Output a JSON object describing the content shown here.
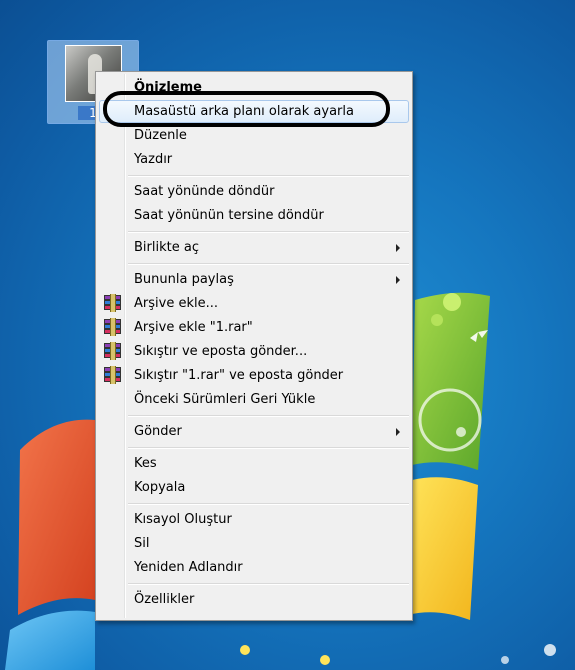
{
  "desktop": {
    "icon_label": "1",
    "accent_colors": {
      "background": "#1576bf",
      "menu_bg": "#f0f0f0",
      "hover": "#dfedfb"
    }
  },
  "context_menu": {
    "items": [
      {
        "label": "Önizleme",
        "bold": true
      },
      {
        "label": "Masaüstü arka planı olarak ayarla",
        "highlighted": true
      },
      {
        "label": "Düzenle"
      },
      {
        "label": "Yazdır"
      },
      {
        "label": "Saat yönünde döndür"
      },
      {
        "label": "Saat yönünün tersine döndür"
      },
      {
        "label": "Birlikte aç",
        "submenu": true
      },
      {
        "label": "Bununla paylaş",
        "submenu": true
      },
      {
        "label": "Arşive ekle...",
        "icon": "winrar-icon"
      },
      {
        "label": "Arşive ekle \"1.rar\"",
        "icon": "winrar-icon"
      },
      {
        "label": "Sıkıştır ve eposta gönder...",
        "icon": "winrar-icon"
      },
      {
        "label": "Sıkıştır \"1.rar\" ve eposta gönder",
        "icon": "winrar-icon"
      },
      {
        "label": "Önceki Sürümleri Geri Yükle"
      },
      {
        "label": "Gönder",
        "submenu": true
      },
      {
        "label": "Kes"
      },
      {
        "label": "Kopyala"
      },
      {
        "label": "Kısayol Oluştur"
      },
      {
        "label": "Sil"
      },
      {
        "label": "Yeniden Adlandır"
      },
      {
        "label": "Özellikler"
      }
    ]
  }
}
